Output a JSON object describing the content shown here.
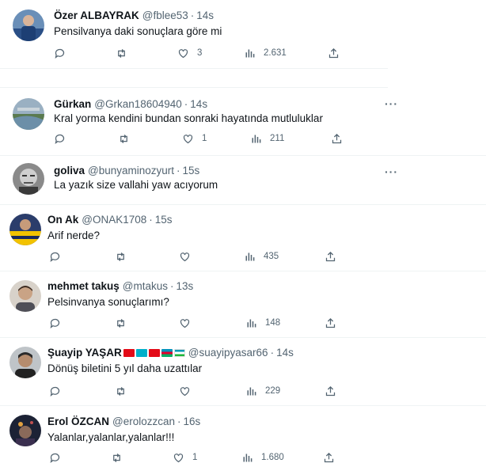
{
  "tweets": [
    {
      "name": "Özer ALBAYRAK",
      "handle": "@fblee53",
      "dot": "·",
      "time": "14s",
      "text": "Pensilvanya daki sonuçlara göre mi",
      "likes": "3",
      "views": "2.631",
      "has_more": false
    },
    {
      "name": "Gürkan",
      "handle": "@Grkan18604940",
      "dot": "·",
      "time": "14s",
      "text": "Kral yorma kendini bundan sonraki hayatında mutluluklar",
      "likes": "1",
      "views": "211",
      "has_more": true
    },
    {
      "name": "goliva",
      "handle": "@bunyaminozyurt",
      "dot": "·",
      "time": "15s",
      "text": "La yazık size vallahi yaw acıyorum",
      "has_more": true
    },
    {
      "name": "On Ak",
      "handle": "@ONAK1708",
      "dot": "·",
      "time": "15s",
      "text": "Arif nerde?",
      "likes": "",
      "views": "435",
      "has_more": false
    },
    {
      "name": "mehmet takuş",
      "handle": "@mtakus",
      "dot": "·",
      "time": "13s",
      "text": "Pelsinvanya sonuçlarımı?",
      "likes": "",
      "views": "148",
      "has_more": false
    },
    {
      "name": "Şuayip YAŞAR",
      "handle": "@suayipyasar66",
      "dot": "·",
      "time": "14s",
      "text": "Dönüş biletini 5 yıl daha uzattılar",
      "likes": "",
      "views": "229",
      "has_more": false
    },
    {
      "name": "Erol ÖZCAN",
      "handle": "@erolozzcan",
      "dot": "·",
      "time": "16s",
      "text": "Yalanlar,yalanlar,yalanlar!!!",
      "likes": "1",
      "views": "1.680",
      "has_more": false
    }
  ],
  "more_label": "···",
  "flag_colors": [
    "#e30a17",
    "#00afca",
    "#e30a17",
    "#0092bc",
    "#0099b5"
  ],
  "icon_color": "#536471"
}
